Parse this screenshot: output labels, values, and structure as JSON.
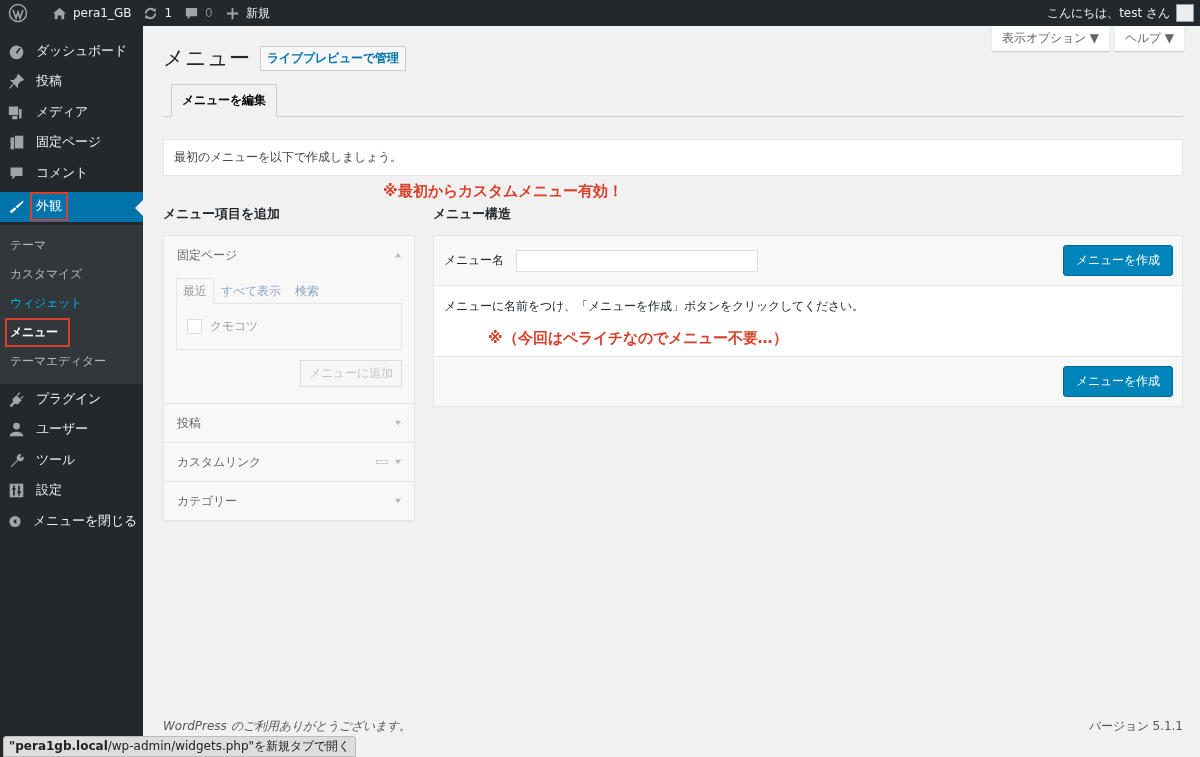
{
  "admin_bar": {
    "site": "pera1_GB",
    "updates": "1",
    "comments": "0",
    "new": "新規",
    "greeting": "こんにちは、test さん"
  },
  "sidebar": {
    "items": [
      {
        "label": "ダッシュボード",
        "selected": false,
        "highlighted": false
      },
      {
        "label": "投稿",
        "selected": false,
        "highlighted": false
      },
      {
        "label": "メディア",
        "selected": false,
        "highlighted": false
      },
      {
        "label": "固定ページ",
        "selected": false,
        "highlighted": false
      },
      {
        "label": "コメント",
        "selected": false,
        "highlighted": false
      },
      {
        "label": "外観",
        "selected": true,
        "highlighted": true,
        "children": [
          {
            "label": "テーマ",
            "selected": false,
            "hovered": false,
            "highlighted": false
          },
          {
            "label": "カスタマイズ",
            "selected": false,
            "hovered": false,
            "highlighted": false
          },
          {
            "label": "ウィジェット",
            "selected": false,
            "hovered": true,
            "highlighted": false
          },
          {
            "label": "メニュー",
            "selected": true,
            "hovered": false,
            "highlighted": true
          },
          {
            "label": "テーマエディター",
            "selected": false,
            "hovered": false,
            "highlighted": false
          }
        ]
      },
      {
        "label": "プラグイン",
        "selected": false,
        "highlighted": false
      },
      {
        "label": "ユーザー",
        "selected": false,
        "highlighted": false
      },
      {
        "label": "ツール",
        "selected": false,
        "highlighted": false
      },
      {
        "label": "設定",
        "selected": false,
        "highlighted": false
      },
      {
        "label": "メニューを閉じる",
        "selected": false,
        "highlighted": false
      }
    ]
  },
  "screen_options": [
    {
      "label": "表示オプション",
      "caret": "▼"
    },
    {
      "label": "ヘルプ",
      "caret": "▼"
    }
  ],
  "page_title": "メニュー",
  "title_action": "ライブプレビューで管理",
  "tabs": [
    {
      "label": "メニューを編集",
      "selected": true
    }
  ],
  "notice": "最初のメニューを以下で作成しましょう。",
  "annotation_top": "※最初からカスタムメニュー有効！",
  "add_items": {
    "heading": "メニュー項目を追加",
    "sections": [
      {
        "title": "固定ページ",
        "expanded": true,
        "has_marker": false,
        "tabs": [
          {
            "label": "最近",
            "selected": true
          },
          {
            "label": "すべて表示",
            "selected": false
          },
          {
            "label": "検索",
            "selected": false
          }
        ],
        "items": [
          {
            "label": "クモコツ",
            "checked": false
          }
        ],
        "button": {
          "label": "メニューに追加",
          "disabled": true
        }
      },
      {
        "title": "投稿",
        "expanded": false,
        "has_marker": false
      },
      {
        "title": "カスタムリンク",
        "expanded": false,
        "has_marker": true
      },
      {
        "title": "カテゴリー",
        "expanded": false,
        "has_marker": false
      }
    ]
  },
  "structure": {
    "heading": "メニュー構造",
    "name_label": "メニュー名",
    "create_button": "メニューを作成",
    "instructions": "メニューに名前をつけ、「メニューを作成」ボタンをクリックしてください。",
    "annotation": "※（今回はペライチなのでメニュー不要…）",
    "footer_button": "メニューを作成"
  },
  "footer": {
    "thanks": "WordPress のご利用ありがとうございます。",
    "version": "バージョン 5.1.1"
  },
  "link_tooltip": {
    "host": "\"pera1gb.local",
    "rest": "/wp-admin/widgets.php\"を新規タブで開く"
  }
}
